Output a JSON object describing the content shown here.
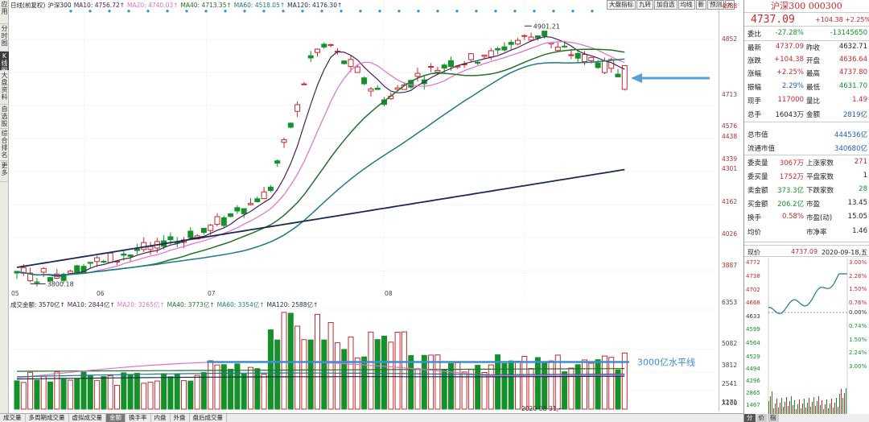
{
  "left_tabs": [
    "应用",
    "分时图",
    "K线图",
    "大盘资料",
    "自选股",
    "综合排名",
    "更多"
  ],
  "main_chart": {
    "legend": [
      {
        "text": "日线(前复权)",
        "color": "#222"
      },
      {
        "text": "沪深300",
        "color": "#222"
      },
      {
        "text": "MA10: 4756.72↑",
        "color": "#4b1d58"
      },
      {
        "text": "MA20: 4740.03↑",
        "color": "#e26fd1"
      },
      {
        "text": "MA40: 4713.35↑",
        "color": "#22722a"
      },
      {
        "text": "MA60: 4518.05↑",
        "color": "#1c7a88"
      },
      {
        "text": "MA120: 4176.30↑",
        "color": "#1b2a55"
      }
    ],
    "high_label": "4901.21",
    "low_label": "3800.18",
    "date_label": "2020-08-31,一",
    "months": [
      "05",
      "06",
      "07",
      "08"
    ],
    "price_ticks": [
      "4988",
      "4852",
      "4713",
      "4576",
      "4438",
      "4339",
      "4301",
      "4162",
      "4026",
      "3887"
    ],
    "annotation_ma_target": "4713"
  },
  "toolbar": [
    "大盘指标",
    "九转",
    "加自选",
    "均线",
    "新",
    "预测",
    "✕"
  ],
  "volume_chart": {
    "legend": [
      {
        "text": "成交金额: 3570亿↑",
        "color": "#222"
      },
      {
        "text": "MA10: 2844亿↑",
        "color": "#4b1d58"
      },
      {
        "text": "MA20: 3265亿↑",
        "color": "#e26fd1"
      },
      {
        "text": "MA40: 3773亿↑",
        "color": "#22722a"
      },
      {
        "text": "MA60: 3354亿↑",
        "color": "#1c7a88"
      },
      {
        "text": "MA120: 2588亿↑",
        "color": "#1b2a55"
      }
    ],
    "ticks": [
      "6353",
      "5082",
      "3812",
      "2541",
      "1271"
    ],
    "unit": "X100",
    "annotation": "3000亿水平线"
  },
  "bottom_tabs": [
    "成交量",
    "多周期成交量",
    "虚拟成交量",
    "金额",
    "换手率",
    "内盘",
    "外盘",
    "盘后成交量"
  ],
  "right_panel": {
    "title": "沪深300 000300",
    "price": "4737.09",
    "change": "+104.38",
    "change_pct": "+2.25%",
    "rows": [
      {
        "l": "委比",
        "v": "-27.28%",
        "vc": "green",
        "r": "",
        "w": "-13145650",
        "wc": "green"
      },
      {
        "l": "最新",
        "v": "4737.09",
        "vc": "red",
        "r": "昨收",
        "w": "4632.71",
        "wc": "dark"
      },
      {
        "l": "涨跌",
        "v": "+104.38",
        "vc": "red",
        "r": "开盘",
        "w": "4636.64",
        "wc": "red"
      },
      {
        "l": "涨幅",
        "v": "+2.25%",
        "vc": "red",
        "r": "最高",
        "w": "4737.80",
        "wc": "red"
      },
      {
        "l": "振幅",
        "v": "2.29%",
        "vc": "blue",
        "r": "最低",
        "w": "4631.70",
        "wc": "green"
      },
      {
        "l": "现手",
        "v": "117000",
        "vc": "red",
        "r": "量比",
        "w": "1.49",
        "wc": "red"
      },
      {
        "l": "总手",
        "v": "16043万",
        "vc": "dark",
        "r": "金额",
        "w": "2819亿",
        "wc": "blue"
      },
      {
        "l": "总市值",
        "v": "",
        "vc": "dark",
        "r": "",
        "w": "444536亿",
        "wc": "blue"
      },
      {
        "l": "流通市值",
        "v": "",
        "vc": "dark",
        "r": "",
        "w": "340680亿",
        "wc": "blue"
      },
      {
        "l": "委卖量",
        "v": "3067万",
        "vc": "red",
        "r": "上涨家数",
        "w": "271",
        "wc": "red"
      },
      {
        "l": "委买量",
        "v": "1752万",
        "vc": "red",
        "r": "平盘家数",
        "w": "1",
        "wc": "dark"
      },
      {
        "l": "卖金额",
        "v": "373.3亿",
        "vc": "green",
        "r": "下跌家数",
        "w": "28",
        "wc": "green"
      },
      {
        "l": "买金额",
        "v": "206.2亿",
        "vc": "green",
        "r": "市盈",
        "w": "13.45",
        "wc": "dark"
      },
      {
        "l": "换手",
        "v": "0.58%",
        "vc": "red",
        "r": "市盈(动)",
        "w": "15.05",
        "wc": "dark"
      },
      {
        "l": "均价",
        "v": "",
        "vc": "dark",
        "r": "市净率",
        "w": "1.46",
        "wc": "dark"
      }
    ],
    "mini": {
      "label": "现价",
      "price": "4737.09",
      "date": "2020-09-18,五",
      "left_ticks": [
        "4772",
        "4738",
        "4702",
        "4668",
        "4633",
        "4599",
        "4564",
        "4529",
        "4494",
        "4296",
        "2865",
        "1467"
      ],
      "right_ticks": [
        "3.00%",
        "2.26%",
        "1.50%",
        "0.76%",
        "0.00%",
        "0.74%",
        "1.50%",
        "2.24%",
        "3.00%"
      ],
      "tabs": [
        "分",
        "价",
        "指"
      ]
    }
  },
  "colors": {
    "up": "#c8282d",
    "down": "#14912a"
  }
}
